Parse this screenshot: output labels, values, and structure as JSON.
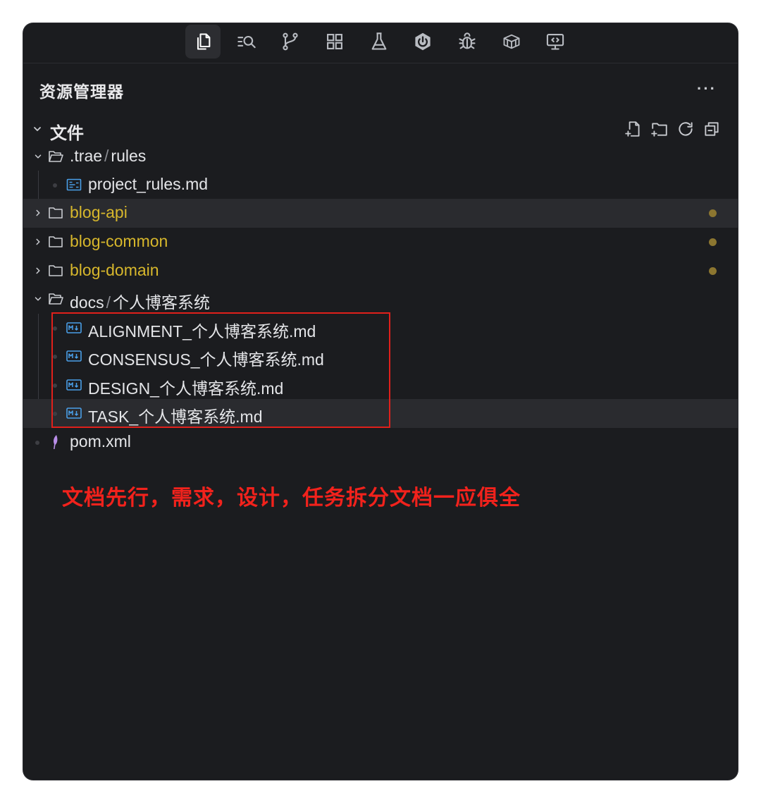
{
  "panel": {
    "title": "资源管理器",
    "more_label": "···",
    "section_label": "文件"
  },
  "tree": {
    "trae_folder": {
      "part1": ".trae",
      "sep": "/",
      "part2": "rules"
    },
    "project_rules": "project_rules.md",
    "blog_api": "blog-api",
    "blog_common": "blog-common",
    "blog_domain": "blog-domain",
    "docs_folder": {
      "part1": "docs",
      "sep": "/",
      "part2": "个人博客系统"
    },
    "alignment": "ALIGNMENT_个人博客系统.md",
    "consensus": "CONSENSUS_个人博客系统.md",
    "design": "DESIGN_个人博客系统.md",
    "task": "TASK_个人博客系统.md",
    "pom": "pom.xml"
  },
  "annotation": "文档先行，需求，设计，任务拆分文档一应俱全",
  "colors": {
    "background": "#1b1c1f",
    "modified_text": "#d7b72c",
    "modified_dot": "#8c7630",
    "annotation_red": "#f2221c",
    "markdown_icon": "#4a9fe8",
    "pom_icon": "#b98ee8"
  },
  "icons": {
    "activity_bar": [
      "files-icon",
      "search-icon",
      "source-control-icon",
      "extensions-icon",
      "testing-icon",
      "spring-boot-icon",
      "debug-icon",
      "container-icon",
      "remote-explorer-icon"
    ],
    "section_actions": [
      "new-file-icon",
      "new-folder-icon",
      "refresh-icon",
      "collapse-all-icon"
    ]
  }
}
